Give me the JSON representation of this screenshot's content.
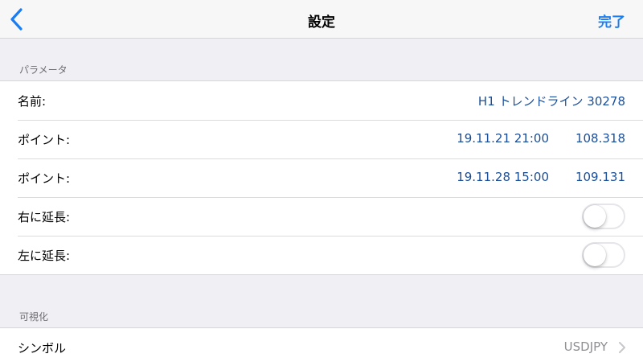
{
  "nav": {
    "title": "設定",
    "done_label": "完了"
  },
  "parameters": {
    "header": "パラメータ",
    "rows": {
      "name": {
        "label": "名前:",
        "value": "H1 トレンドライン 30278"
      },
      "point1": {
        "label": "ポイント:",
        "time": "19.11.21 21:00",
        "price": "108.318"
      },
      "point2": {
        "label": "ポイント:",
        "time": "19.11.28 15:00",
        "price": "109.131"
      },
      "extend_right": {
        "label": "右に延長:",
        "on": false
      },
      "extend_left": {
        "label": "左に延長:",
        "on": false
      }
    }
  },
  "visualization": {
    "header": "可視化",
    "rows": {
      "symbol": {
        "label": "シンボル",
        "value": "USDJPY"
      }
    }
  },
  "colors": {
    "accent": "#1a7ef2",
    "value_text": "#1a4f98",
    "secondary_text": "#8e8e93",
    "background": "#efeff4"
  },
  "icons": {
    "back": "chevron-left-icon",
    "disclosure": "chevron-right-icon"
  }
}
